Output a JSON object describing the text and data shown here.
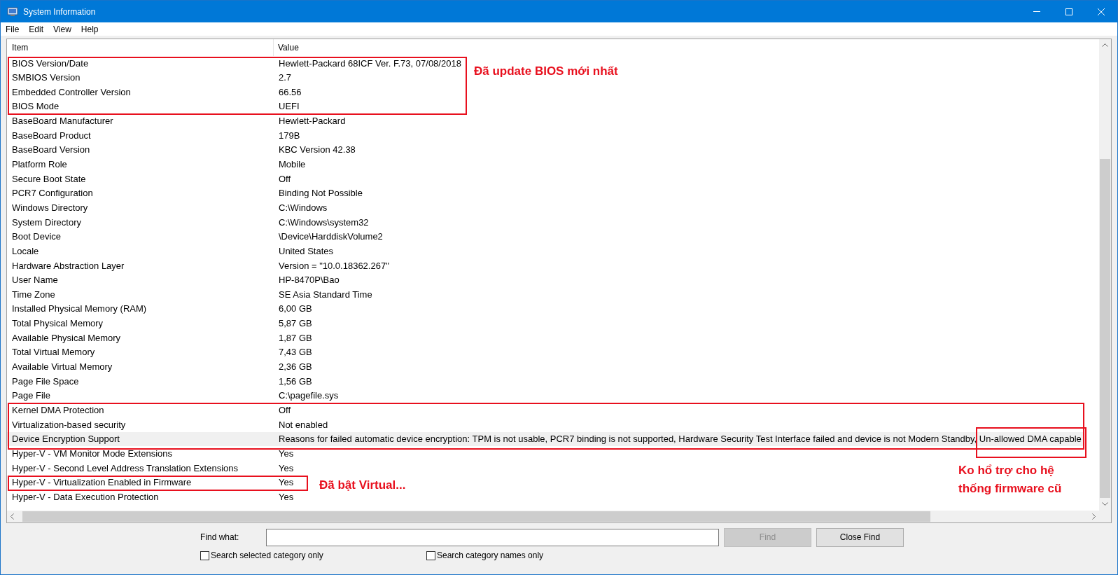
{
  "window": {
    "title": "System Information"
  },
  "menu": [
    "File",
    "Edit",
    "View",
    "Help"
  ],
  "table": {
    "columns": [
      "Item",
      "Value"
    ],
    "rows": [
      {
        "item": "BIOS Version/Date",
        "value": "Hewlett-Packard 68ICF Ver. F.73, 07/08/2018",
        "selected": false
      },
      {
        "item": "SMBIOS Version",
        "value": "2.7",
        "selected": false
      },
      {
        "item": "Embedded Controller Version",
        "value": "66.56",
        "selected": false
      },
      {
        "item": "BIOS Mode",
        "value": "UEFI",
        "selected": false
      },
      {
        "item": "BaseBoard Manufacturer",
        "value": "Hewlett-Packard",
        "selected": false
      },
      {
        "item": "BaseBoard Product",
        "value": "179B",
        "selected": false
      },
      {
        "item": "BaseBoard Version",
        "value": "KBC Version 42.38",
        "selected": false
      },
      {
        "item": "Platform Role",
        "value": "Mobile",
        "selected": false
      },
      {
        "item": "Secure Boot State",
        "value": "Off",
        "selected": false
      },
      {
        "item": "PCR7 Configuration",
        "value": "Binding Not Possible",
        "selected": false
      },
      {
        "item": "Windows Directory",
        "value": "C:\\Windows",
        "selected": false
      },
      {
        "item": "System Directory",
        "value": "C:\\Windows\\system32",
        "selected": false
      },
      {
        "item": "Boot Device",
        "value": "\\Device\\HarddiskVolume2",
        "selected": false
      },
      {
        "item": "Locale",
        "value": "United States",
        "selected": false
      },
      {
        "item": "Hardware Abstraction Layer",
        "value": "Version = \"10.0.18362.267\"",
        "selected": false
      },
      {
        "item": "User Name",
        "value": "HP-8470P\\Bao",
        "selected": false
      },
      {
        "item": "Time Zone",
        "value": "SE Asia Standard Time",
        "selected": false
      },
      {
        "item": "Installed Physical Memory (RAM)",
        "value": "6,00 GB",
        "selected": false
      },
      {
        "item": "Total Physical Memory",
        "value": "5,87 GB",
        "selected": false
      },
      {
        "item": "Available Physical Memory",
        "value": "1,87 GB",
        "selected": false
      },
      {
        "item": "Total Virtual Memory",
        "value": "7,43 GB",
        "selected": false
      },
      {
        "item": "Available Virtual Memory",
        "value": "2,36 GB",
        "selected": false
      },
      {
        "item": "Page File Space",
        "value": "1,56 GB",
        "selected": false
      },
      {
        "item": "Page File",
        "value": "C:\\pagefile.sys",
        "selected": false
      },
      {
        "item": "Kernel DMA Protection",
        "value": "Off",
        "selected": false
      },
      {
        "item": "Virtualization-based security",
        "value": "Not enabled",
        "selected": false
      },
      {
        "item": "Device Encryption Support",
        "value": "Reasons for failed automatic device encryption: TPM is not usable, PCR7 binding is not supported, Hardware Security Test Interface failed and device is not Modern Standby, Un-allowed DMA capable",
        "selected": true
      },
      {
        "item": "Hyper-V - VM Monitor Mode Extensions",
        "value": "Yes",
        "selected": false
      },
      {
        "item": "Hyper-V - Second Level Address Translation Extensions",
        "value": "Yes",
        "selected": false
      },
      {
        "item": "Hyper-V - Virtualization Enabled in Firmware",
        "value": "Yes",
        "selected": false
      },
      {
        "item": "Hyper-V - Data Execution Protection",
        "value": "Yes",
        "selected": false
      }
    ]
  },
  "annotations": [
    "Đã update BIOS mới nhất",
    "Đã bật Virtual...",
    "Ko hổ trợ cho hệ thống firmware cũ"
  ],
  "find_bar": {
    "label": "Find what:",
    "find_button": {
      "label": "Find",
      "disabled": true
    },
    "close_button": "Close Find",
    "checkboxes": [
      {
        "label": "Search selected category only",
        "checked": false
      },
      {
        "label": "Search category names only",
        "checked": false
      }
    ]
  }
}
